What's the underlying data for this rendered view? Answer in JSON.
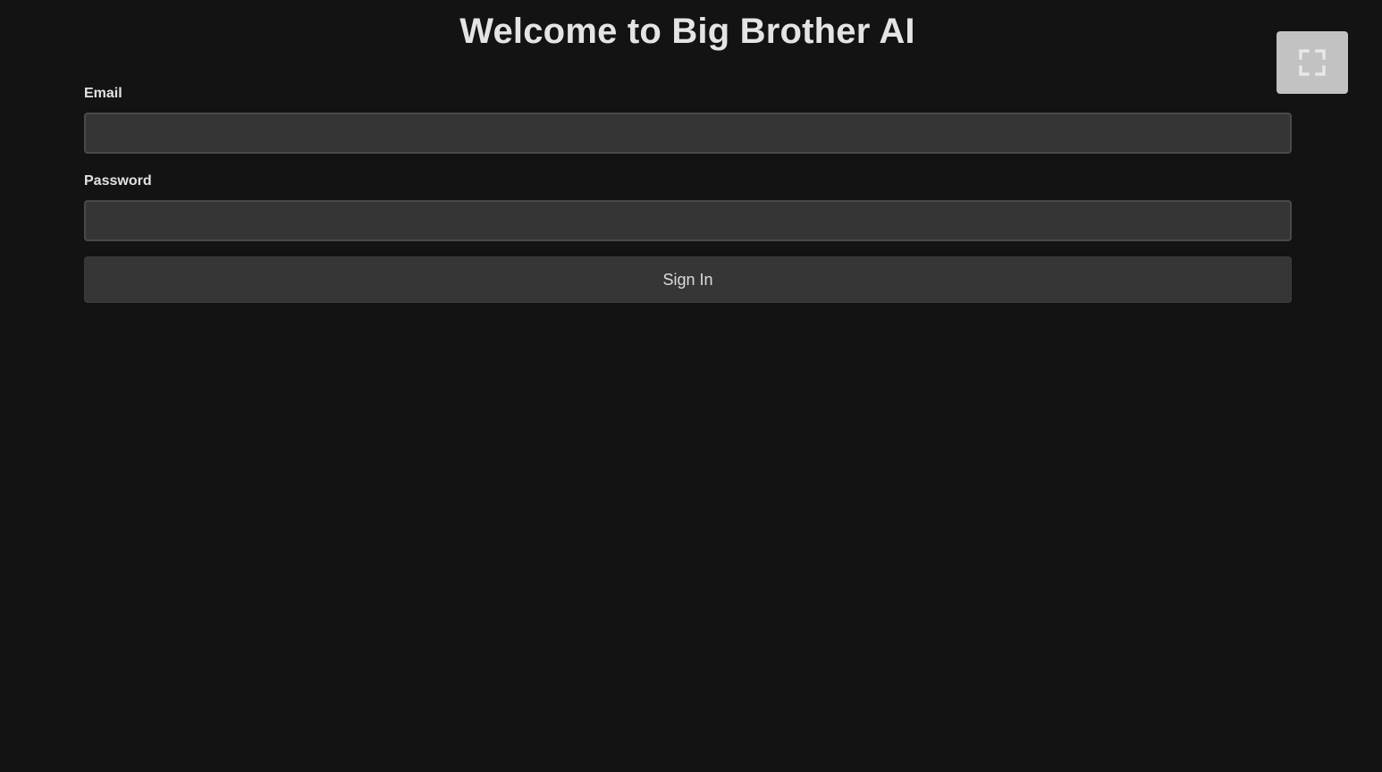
{
  "header": {
    "title": "Welcome to Big Brother AI"
  },
  "form": {
    "email_label": "Email",
    "email_value": "",
    "password_label": "Password",
    "password_value": "",
    "submit_label": "Sign In"
  },
  "toolbar": {
    "fullscreen_icon": "fullscreen-icon"
  },
  "colors": {
    "background": "#131313",
    "input_background": "#353535",
    "button_background": "#363636",
    "fullscreen_button": "#c2c2c2",
    "fullscreen_icon": "#e8e8e8"
  }
}
